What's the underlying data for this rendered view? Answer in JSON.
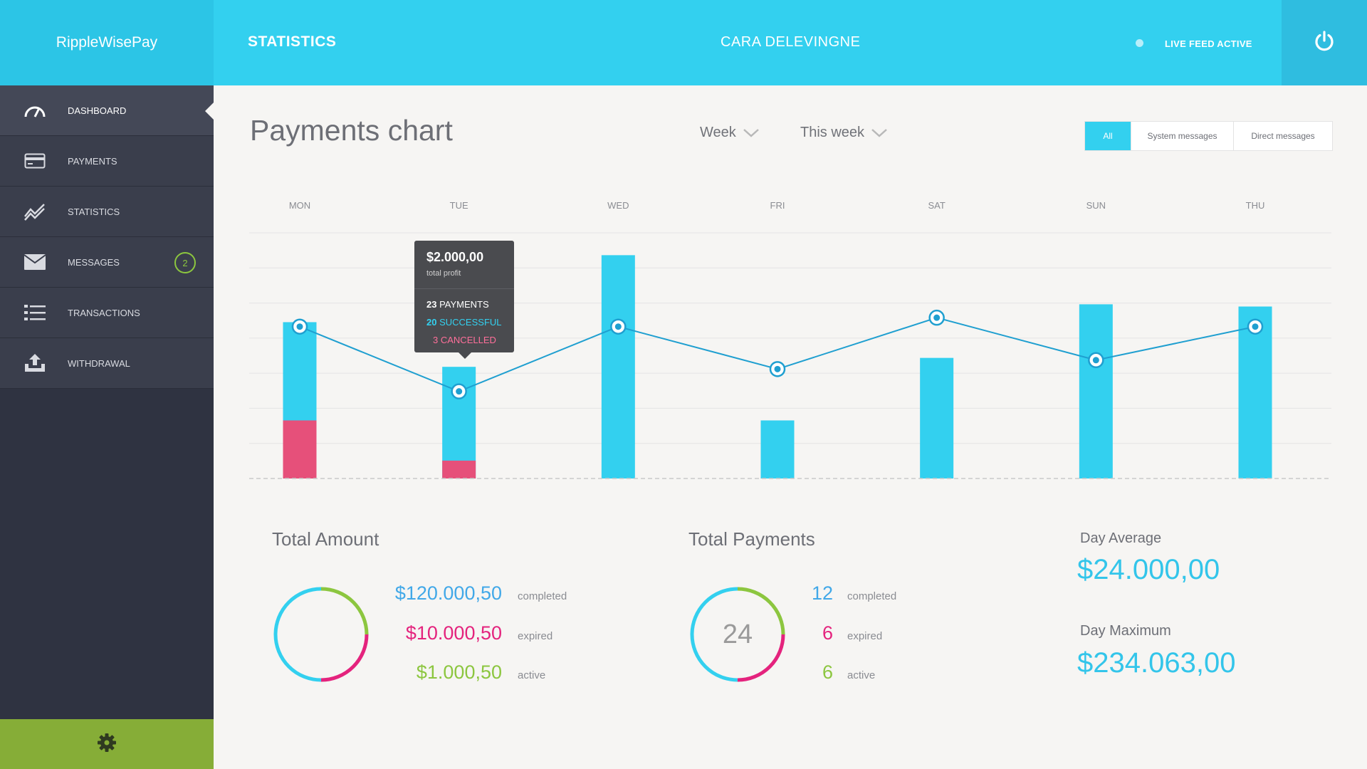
{
  "app": {
    "brand": "RippleWisePay"
  },
  "topbar": {
    "title": "STATISTICS",
    "user": "CARA DELEVINGNE",
    "live_status": "LIVE FEED ACTIVE"
  },
  "sidebar": {
    "items": [
      {
        "label": "DASHBOARD",
        "icon": "speedometer-icon",
        "active": true
      },
      {
        "label": "PAYMENTS",
        "icon": "credit-card-icon"
      },
      {
        "label": "STATISTICS",
        "icon": "chart-line-icon"
      },
      {
        "label": "MESSAGES",
        "icon": "envelope-icon",
        "badge": "2"
      },
      {
        "label": "TRANSACTIONS",
        "icon": "list-icon"
      },
      {
        "label": "WITHDRAWAL",
        "icon": "upload-tray-icon"
      }
    ],
    "settings_icon": "gear-icon"
  },
  "main": {
    "title": "Payments chart",
    "period_dropdown": "Week",
    "range_dropdown": "This week",
    "filters": [
      "All",
      "System messages",
      "Direct messages"
    ],
    "active_filter": "All"
  },
  "tooltip": {
    "amount": "$2.000,00",
    "sub": "total profit",
    "payments_count": "23",
    "payments_label": "PAYMENTS",
    "successful_count": "20",
    "successful_label": "SUCCESSFUL",
    "cancelled_count": "3",
    "cancelled_label": "CANCELLED"
  },
  "chart_data": {
    "type": "bar",
    "categories": [
      "MON",
      "TUE",
      "WED",
      "FRI",
      "SAT",
      "SUN",
      "THU"
    ],
    "series": [
      {
        "values": [
          7.0,
          5.0,
          10.0,
          2.6,
          5.4,
          7.8,
          7.7
        ]
      },
      {
        "values": [
          2.6,
          0.8,
          0,
          0,
          0,
          0,
          0
        ]
      }
    ],
    "line_series": [
      {
        "values": [
          6.8,
          3.9,
          6.8,
          4.9,
          7.2,
          5.3,
          6.8
        ]
      }
    ],
    "ylim": [
      0,
      11
    ],
    "grid": true,
    "colors": {
      "successful": "#33d0ef",
      "cancelled": "#e6507a",
      "line": "#1f9fd0",
      "grid": "#e4e4e4"
    }
  },
  "stats": {
    "total_amount": {
      "title": "Total Amount",
      "rows": [
        {
          "value": "$120.000,50",
          "label": "completed",
          "color": "#41a8e8"
        },
        {
          "value": "$10.000,50",
          "label": "expired",
          "color": "#e4237d"
        },
        {
          "value": "$1.000,50",
          "label": "active",
          "color": "#8cc63f"
        }
      ]
    },
    "total_payments": {
      "title": "Total Payments",
      "center": "24",
      "rows": [
        {
          "value": "12",
          "label": "completed",
          "color": "#41a8e8"
        },
        {
          "value": "6",
          "label": "expired",
          "color": "#e4237d"
        },
        {
          "value": "6",
          "label": "active",
          "color": "#8cc63f"
        }
      ]
    },
    "day_average": {
      "title": "Day Average",
      "value": "$24.000,00"
    },
    "day_maximum": {
      "title": "Day Maximum",
      "value": "$234.063,00"
    },
    "donut_shares": [
      0.5,
      0.25,
      0.25
    ]
  }
}
